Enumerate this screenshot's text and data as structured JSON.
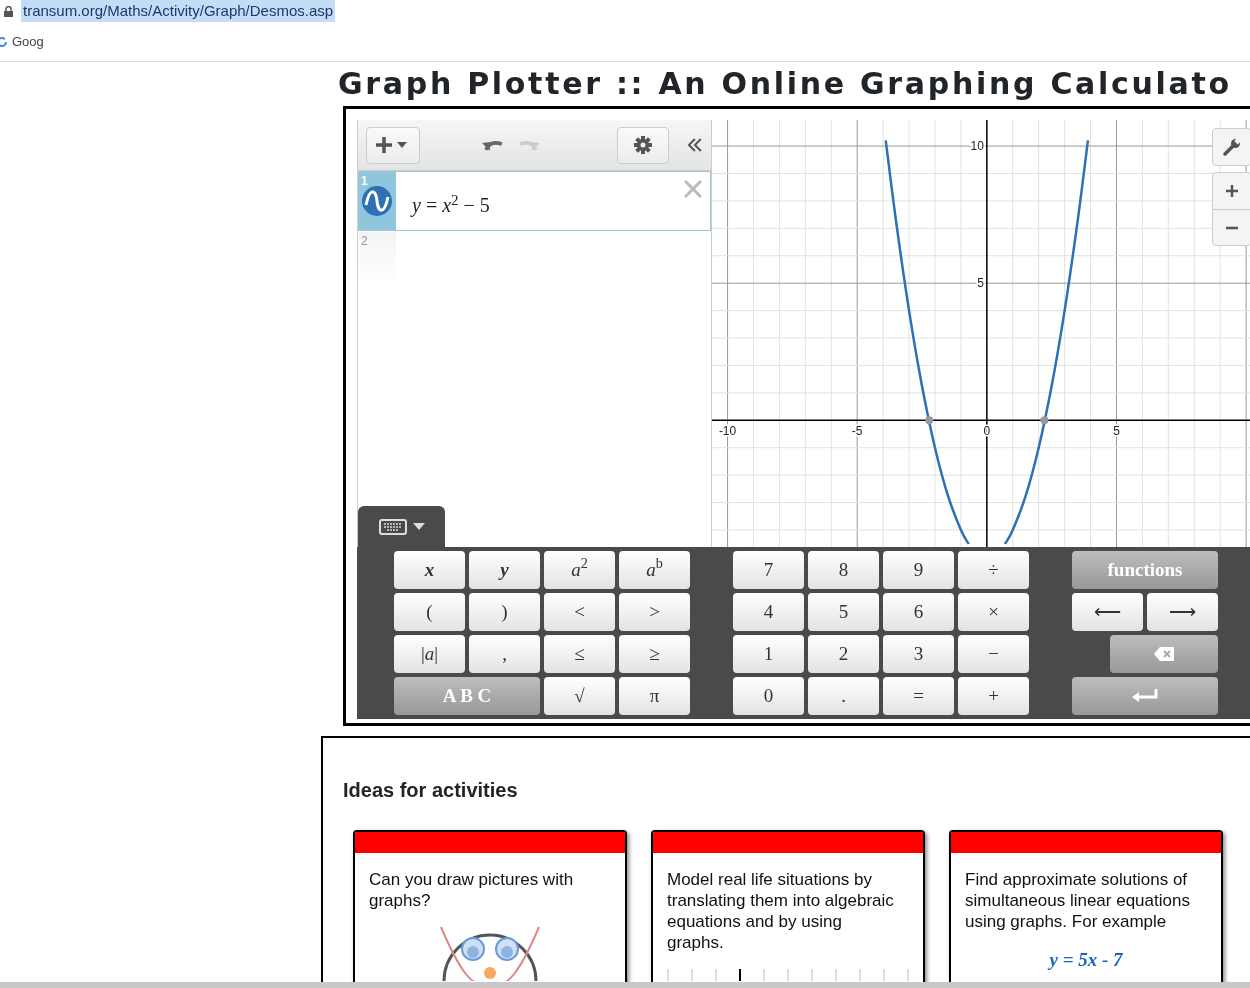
{
  "browser": {
    "url": "transum.org/Maths/Activity/Graph/Desmos.asp",
    "bookmarks": [
      {
        "label": "Goog"
      }
    ]
  },
  "page_title": "Graph Plotter :: An Online Graphing Calculato",
  "calculator": {
    "expressions": [
      {
        "number": "1",
        "latex": "*y* = *x*$^{2}$ − 5",
        "selected": true
      },
      {
        "number": "2",
        "selected": false
      }
    ],
    "keyboard": {
      "expanded": true
    },
    "graph": {
      "chart_data": {
        "type": "line",
        "xlim": [
          -10.6,
          10.15
        ],
        "ylim": [
          -4.62,
          10.95
        ],
        "grid": true,
        "xticks": [
          -10,
          -5,
          0,
          5
        ],
        "yticks": [
          5,
          10
        ],
        "x": [
          -3.9,
          -3.5,
          -3,
          -2.5,
          -2,
          -1.5,
          -1,
          -0.7,
          0,
          0.7,
          1,
          1.5,
          2,
          2.5,
          3,
          3.5,
          3.9
        ],
        "series": [
          {
            "color": "#2d70b3",
            "values": [
              10.21,
              7.25,
              4,
              1.25,
              -1,
              -2.75,
              -4,
              -4.51,
              null,
              -4.51,
              -4,
              -2.75,
              -1,
              1.25,
              4,
              7.25,
              10.21
            ]
          }
        ]
      }
    },
    "keypad": {
      "groups": [
        {
          "keys": [
            {
              "label": "x",
              "kind": "var"
            },
            {
              "label": "y",
              "kind": "var"
            },
            {
              "label": "*a*$^{2}$",
              "kind": "key"
            },
            {
              "label": "*a*$^{b}$",
              "kind": "key"
            },
            {
              "label": "(",
              "kind": "key"
            },
            {
              "label": ")",
              "kind": "key"
            },
            {
              "label": "<",
              "kind": "key"
            },
            {
              "label": ">",
              "kind": "key"
            },
            {
              "label": "|*a*|",
              "kind": "key"
            },
            {
              "label": ",",
              "kind": "key"
            },
            {
              "label": "≤",
              "kind": "key"
            },
            {
              "label": "≥",
              "kind": "key"
            },
            {
              "label": "A B C",
              "kind": "dark_wide"
            },
            {
              "label": "√",
              "kind": "key"
            },
            {
              "label": "π",
              "kind": "key"
            }
          ]
        },
        {
          "keys": [
            {
              "label": "7",
              "kind": "key"
            },
            {
              "label": "8",
              "kind": "key"
            },
            {
              "label": "9",
              "kind": "key"
            },
            {
              "label": "÷",
              "kind": "key"
            },
            {
              "label": "4",
              "kind": "key"
            },
            {
              "label": "5",
              "kind": "key"
            },
            {
              "label": "6",
              "kind": "key"
            },
            {
              "label": "×",
              "kind": "key"
            },
            {
              "label": "1",
              "kind": "key"
            },
            {
              "label": "2",
              "kind": "key"
            },
            {
              "label": "3",
              "kind": "key"
            },
            {
              "label": "−",
              "kind": "key"
            },
            {
              "label": "0",
              "kind": "key"
            },
            {
              "label": ".",
              "kind": "key"
            },
            {
              "label": "=",
              "kind": "key"
            },
            {
              "label": "+",
              "kind": "key"
            }
          ]
        },
        {
          "keys": [
            {
              "label": "functions",
              "kind": "dark_wide"
            },
            {
              "label": "⟵",
              "kind": "key"
            },
            {
              "label": "⟶",
              "kind": "key"
            },
            {
              "kind": "backspace"
            },
            {
              "kind": "enter"
            }
          ]
        }
      ]
    }
  },
  "activities": {
    "heading": "Ideas for activities",
    "cards": [
      {
        "text": "Can you draw pictures with graphs?",
        "kind": "sketch"
      },
      {
        "text": "Model real life situations by translating them into algebraic equations and by using graphs.",
        "kind": "ruler"
      },
      {
        "text": "Find approximate solutions of simultaneous linear equations using graphs. For example",
        "kind": "equation",
        "equation": "y = 5x - 7"
      }
    ]
  }
}
